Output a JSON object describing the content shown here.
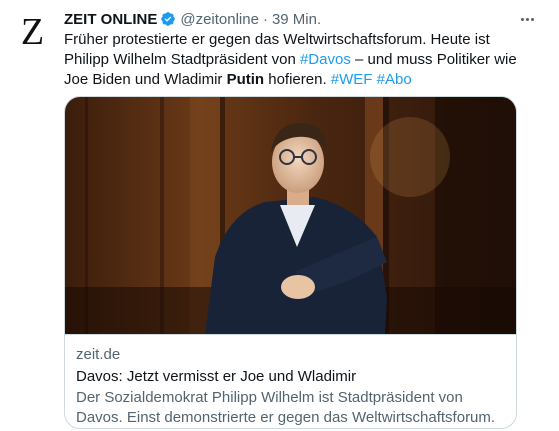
{
  "tweet": {
    "avatar_letter": "Z",
    "display_name": "ZEIT ONLINE",
    "handle": "@zeitonline",
    "separator": "·",
    "time": "39 Min.",
    "text_parts": [
      "Früher protestierte er gegen das Weltwirtschaftsforum. Heute ist Philipp Wilhelm Stadtpräsident von ",
      "#Davos",
      " – und muss Politiker wie Joe Biden und Wladimir ",
      "Putin",
      " hofieren. ",
      "#WEF",
      " ",
      "#Abo"
    ]
  },
  "card": {
    "domain": "zeit.de",
    "title": "Davos: Jetzt vermisst er Joe und Wladimir",
    "description": "Der Sozialdemokrat Philipp Wilhelm ist Stadtpräsident von Davos. Einst demonstrierte er gegen das Weltwirtschaftsforum. Heute muss er die …"
  },
  "icons": {
    "verified": "verified-badge-icon",
    "more": "more-options-icon"
  },
  "colors": {
    "link": "#1d9bf0",
    "secondary_text": "#536471",
    "primary_text": "#0f1419",
    "border": "#cfd9de"
  }
}
